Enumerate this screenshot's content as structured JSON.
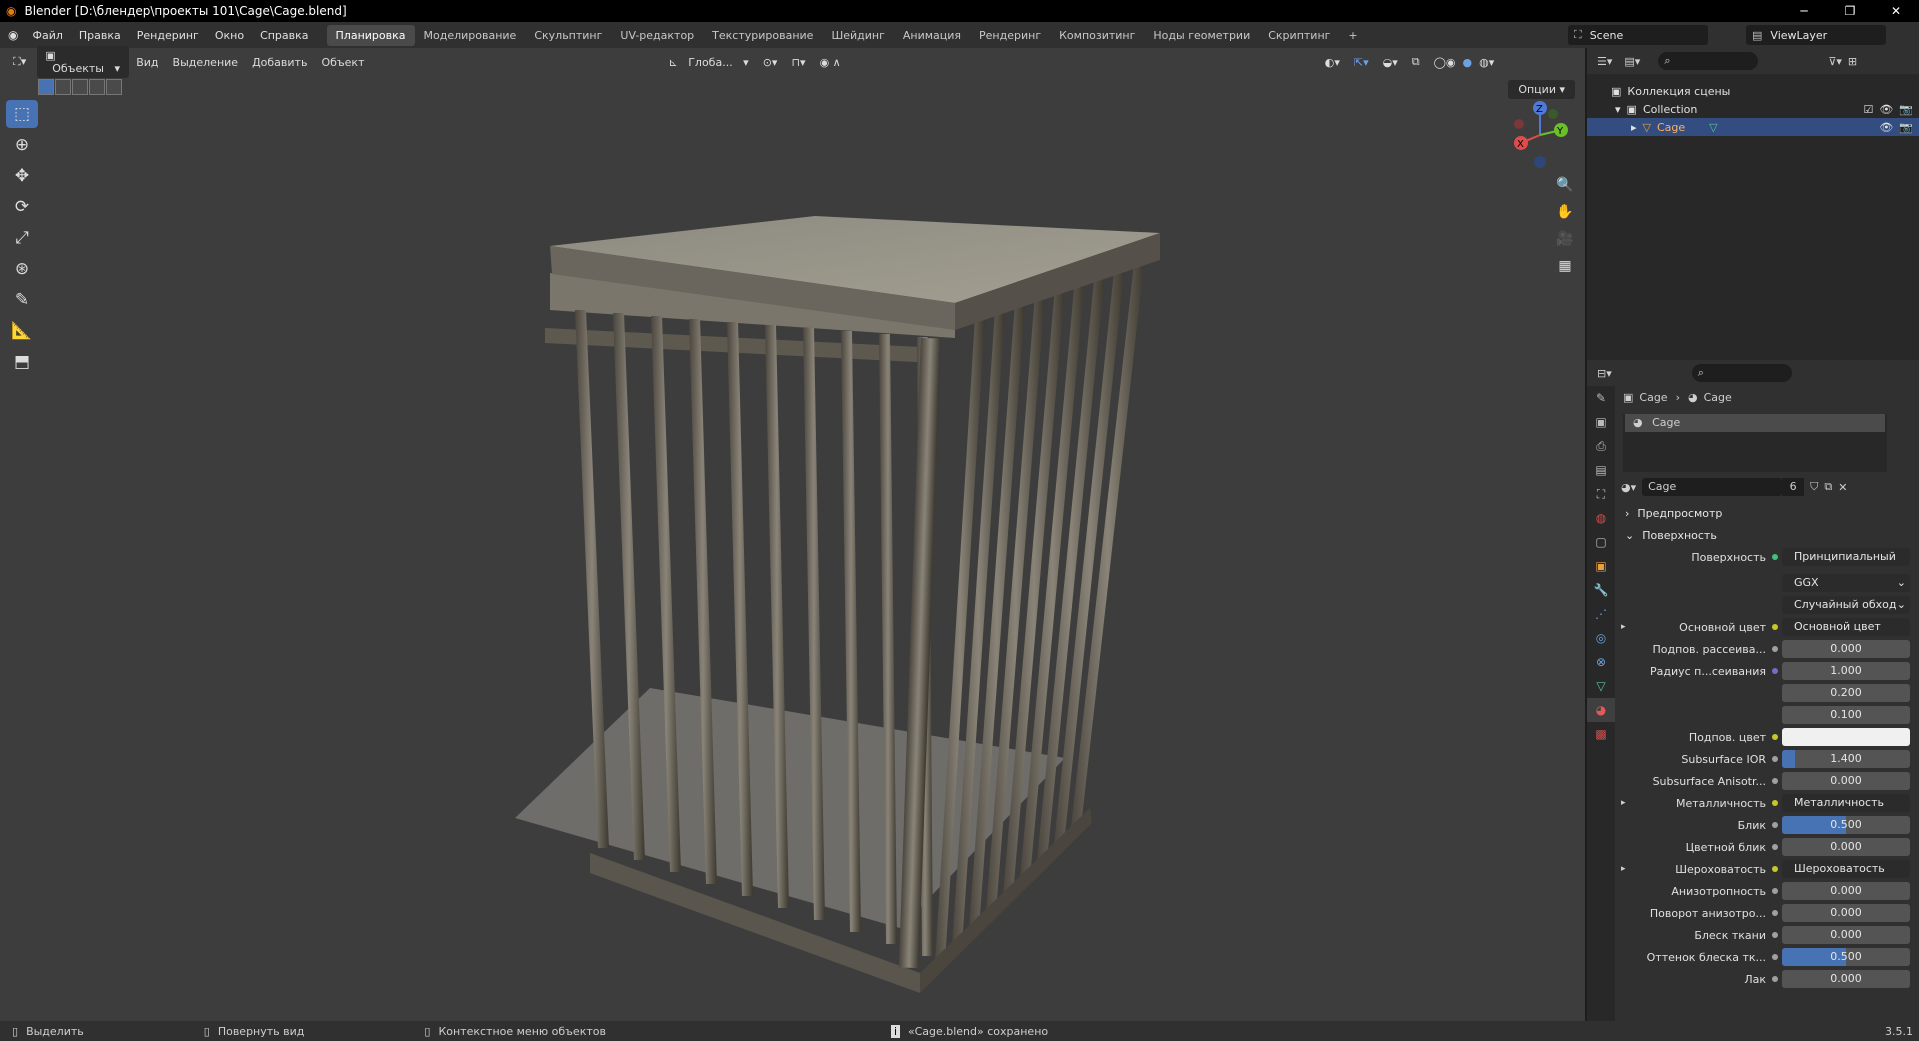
{
  "window": {
    "title": "Blender [D:\\блендер\\проекты 101\\Cage\\Cage.blend]",
    "minimize": "─",
    "maximize": "❐",
    "close": "✕"
  },
  "menu": [
    "Файл",
    "Правка",
    "Рендеринг",
    "Окно",
    "Справка"
  ],
  "workspaces": [
    "Планировка",
    "Моделирование",
    "Скульптинг",
    "UV-редактор",
    "Текстурирование",
    "Шейдинг",
    "Анимация",
    "Рендеринг",
    "Композитинг",
    "Ноды геометрии",
    "Скриптинг",
    "+"
  ],
  "active_workspace": "Планировка",
  "scene": "Scene",
  "view_layer": "ViewLayer",
  "viewport": {
    "mode": "Объекты",
    "menus": [
      "Вид",
      "Выделение",
      "Добавить",
      "Объект"
    ],
    "orientation": "Глоба...",
    "options": "Опции",
    "gizmo_labels": {
      "x": "X",
      "y": "Y",
      "z": "Z"
    }
  },
  "outliner": {
    "scene_collection": "Коллекция сцены",
    "collection": "Collection",
    "object": "Cage"
  },
  "properties": {
    "breadcrumb": [
      "Cage",
      "Cage"
    ],
    "slot": "Cage",
    "material_name": "Cage",
    "users": "6",
    "sections": {
      "preview": "Предпросмотр",
      "surface": "Поверхность"
    },
    "surface_label": "Поверхность",
    "surface_shader": "Принципиальный BSDF",
    "distribution": "GGX",
    "subsurface_method": "Случайный обход",
    "rows": [
      {
        "label": "Основной цвет",
        "value": "Основной цвет",
        "type": "link",
        "expand": true
      },
      {
        "label": "Подпов. рассеива...",
        "value": "0.000",
        "fill": 0
      },
      {
        "label": "Радиус п...сеивания",
        "value": "1.000",
        "fill": 0,
        "dot": "#6f6fc7"
      },
      {
        "label": "",
        "value": "0.200",
        "fill": 0,
        "nodot": true
      },
      {
        "label": "",
        "value": "0.100",
        "fill": 0,
        "nodot": true
      },
      {
        "label": "Подпов. цвет",
        "value": "",
        "type": "color",
        "dot": "#c7c729"
      },
      {
        "label": "Subsurface IOR",
        "value": "1.400",
        "fill": 0.1
      },
      {
        "label": "Subsurface Anisotr...",
        "value": "0.000",
        "fill": 0
      },
      {
        "label": "Металличность",
        "value": "Металличность",
        "type": "link",
        "expand": true
      },
      {
        "label": "Блик",
        "value": "0.500",
        "fill": 0.5
      },
      {
        "label": "Цветной блик",
        "value": "0.000",
        "fill": 0
      },
      {
        "label": "Шероховатость",
        "value": "Шероховатость",
        "type": "link",
        "expand": true
      },
      {
        "label": "Анизотропность",
        "value": "0.000",
        "fill": 0
      },
      {
        "label": "Поворот анизотро...",
        "value": "0.000",
        "fill": 0
      },
      {
        "label": "Блеск ткани",
        "value": "0.000",
        "fill": 0
      },
      {
        "label": "Оттенок блеска тк...",
        "value": "0.500",
        "fill": 0.5
      },
      {
        "label": "Лак",
        "value": "0.000",
        "fill": 0
      }
    ]
  },
  "status": {
    "select": "Выделить",
    "rotate": "Повернуть вид",
    "context": "Контекстное меню объектов",
    "message": "«Cage.blend» сохранено",
    "version": "3.5.1"
  },
  "colors": {
    "accent": "#4772b3",
    "viewport_bg": "#3d3d3d",
    "panel_bg": "#303030",
    "selected_row": "#334d80"
  }
}
